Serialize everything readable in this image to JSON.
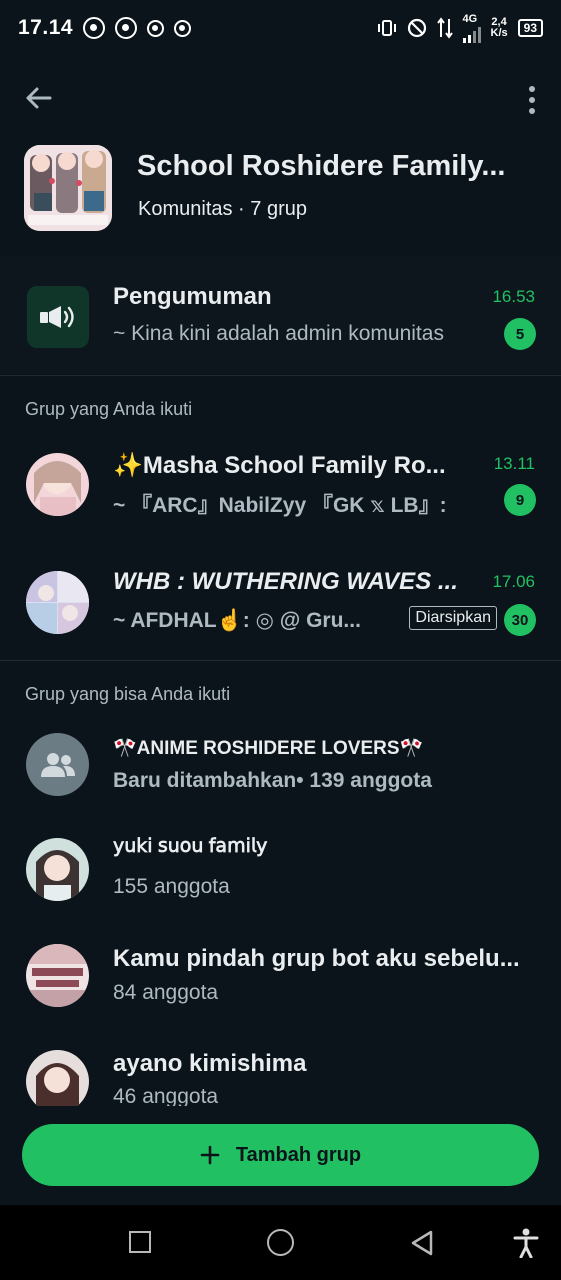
{
  "status_bar": {
    "time": "17.14",
    "network": "4G",
    "speed_value": "2,4",
    "speed_unit": "K/s",
    "battery": "93"
  },
  "community": {
    "name": "School Roshidere Family...",
    "subtitle": "Komunitas · 7 grup"
  },
  "announcement": {
    "title": "Pengumuman",
    "message": "~ Kina kini adalah admin komunitas",
    "time": "16.53",
    "unread": "5"
  },
  "joined_section": {
    "label": "Grup yang Anda ikuti",
    "groups": [
      {
        "name": "✨Masha School Family Ro...",
        "message": "~ 『ARC』NabilZyy 『GK 𝕩 LB』:",
        "time": "13.11",
        "unread": "9"
      },
      {
        "name": "WHB : WUTHERING WAVES ...",
        "message": "~ AFDHAL☝️: ◎ @ Gru...",
        "time": "17.06",
        "unread": "30",
        "tag": "Diarsipkan"
      }
    ]
  },
  "available_section": {
    "label": "Grup yang bisa Anda ikuti",
    "groups": [
      {
        "name": "🎌ANIME ROSHIDERE LOVERS🎌",
        "info": "Baru ditambahkan• 139 anggota"
      },
      {
        "name": "𝗒𝗎𝗄𝗂 𝗌𝗎𝗈𝗎 𝖿𝖺𝗆𝗂𝗅𝗒",
        "info": "155 anggota"
      },
      {
        "name": "Kamu pindah grup bot aku sebelu...",
        "info": "84 anggota"
      },
      {
        "name": " ayano kimishima",
        "info": "46 anggota"
      }
    ]
  },
  "add_button": {
    "label": "Tambah grup",
    "icon": "plus-icon"
  },
  "colors": {
    "background": "#0b141a",
    "accent": "#21c063",
    "text": "#e9edef",
    "muted": "#aebac1"
  }
}
